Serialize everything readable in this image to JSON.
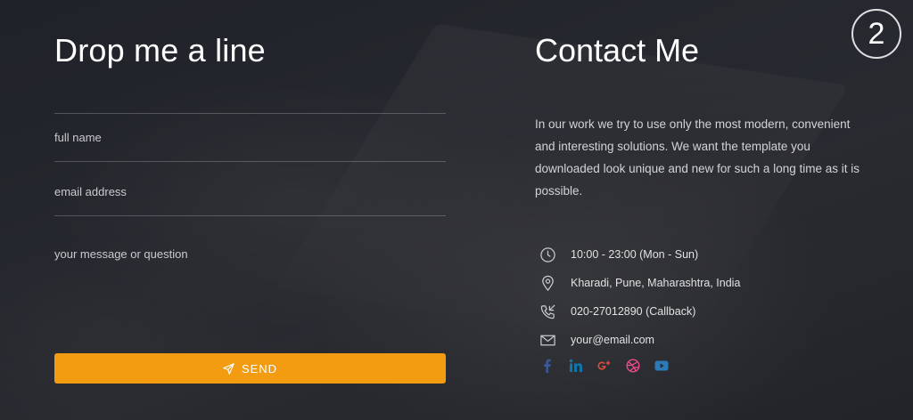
{
  "form": {
    "title": "Drop me a line",
    "name_placeholder": "full name",
    "email_placeholder": "email address",
    "message_placeholder": "your message or question",
    "send_label": "SEND"
  },
  "contact": {
    "title": "Contact Me",
    "intro": "In our work we try to use only the most modern, convenient and interesting solutions. We want the template you downloaded look unique and new for such a long time as it is possible.",
    "hours": "10:00 - 23:00 (Mon - Sun)",
    "address": "Kharadi, Pune, Maharashtra, India",
    "phone": "020-27012890 (Callback)",
    "email": "your@email.com"
  },
  "social": [
    {
      "icon": "facebook-icon",
      "color": "#3b5998"
    },
    {
      "icon": "linkedin-icon",
      "color": "#0e76a8"
    },
    {
      "icon": "google-plus-icon",
      "color": "#dd4b39"
    },
    {
      "icon": "dribbble-icon",
      "color": "#ea4c89"
    },
    {
      "icon": "youtube-icon",
      "color": "#2b7bb9"
    }
  ],
  "step_badge": "2",
  "colors": {
    "accent": "#f39c12",
    "text": "#ffffff",
    "muted": "#c9cacd"
  }
}
